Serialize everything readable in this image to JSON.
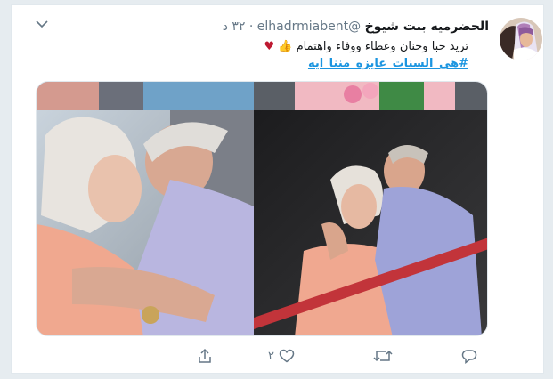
{
  "tweet": {
    "display_name": "الحضرميه بنت شيوخ",
    "handle": "@elhadrmiabent",
    "separator": "·",
    "time": "٣٢ د",
    "text_line1": "تريد حبا وحنان وعطاء ووفاء واهتمام",
    "thumb_emoji": "👍",
    "heart_emoji": "♥",
    "hashtag": "#هي_السنات_عايزه_مننا_ايه"
  },
  "actions": {
    "reply_icon": "reply-icon",
    "retweet_icon": "retweet-icon",
    "like_icon": "heart-outline-icon",
    "like_count": "٢",
    "share_icon": "share-icon"
  },
  "colors": {
    "background": "#e6ecf0",
    "card": "#ffffff",
    "text": "#14171a",
    "muted": "#657786",
    "link": "#1b95e0",
    "heart": "#be1931"
  }
}
